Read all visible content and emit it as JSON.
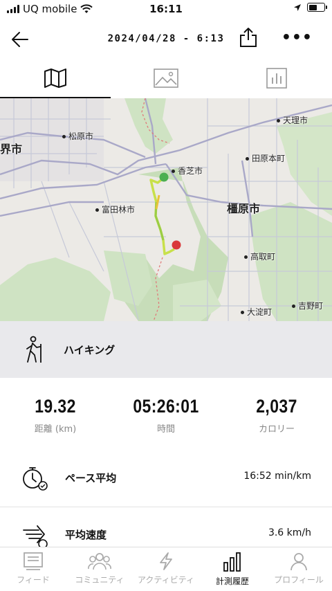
{
  "status_bar": {
    "carrier": "UQ mobile",
    "time": "16:11"
  },
  "header": {
    "title": "2024/04/28 - 6:13"
  },
  "tabs": [
    {
      "name": "map-tab",
      "icon": "map-icon"
    },
    {
      "name": "photo-tab",
      "icon": "image-icon"
    },
    {
      "name": "chart-tab",
      "icon": "bar-chart-icon"
    }
  ],
  "map": {
    "labels": {
      "tenri": "天理市",
      "matsubara": "松原市",
      "sakai": "界市",
      "kashiba": "香芝市",
      "tawaramoto": "田原本町",
      "tondabayashi": "富田林市",
      "kashihara": "橿原市",
      "takatori": "高取町",
      "oyodo": "大淀町",
      "yoshino": "吉野町"
    }
  },
  "activity": {
    "name": "ハイキング",
    "icon": "hiking-icon"
  },
  "stats": {
    "distance": {
      "value": "19.32",
      "label": "距離 (km)"
    },
    "time": {
      "value": "05:26:01",
      "label": "時間"
    },
    "calories": {
      "value": "2,037",
      "label": "カロリー"
    }
  },
  "rows": {
    "pace": {
      "label": "ペース平均",
      "value": "16:52 min/km",
      "icon": "stopwatch-icon"
    },
    "speed": {
      "label": "平均速度",
      "value": "3.6 km/h",
      "icon": "speed-icon"
    }
  },
  "nav": {
    "feed": "フィード",
    "community": "コミュニティ",
    "activity": "アクティビティ",
    "history": "計測履歴",
    "profile": "プロフィール"
  },
  "colors": {
    "accent": "#111111",
    "inactive": "#aaaaaa",
    "start_marker": "#4caf50",
    "end_marker": "#d9383a"
  }
}
